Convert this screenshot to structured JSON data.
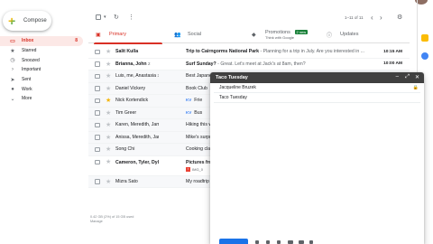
{
  "compose_label": "Compose",
  "nav": [
    {
      "label": "Inbox",
      "icon": "inbox-icon",
      "glyph": "▭",
      "count": "8",
      "active": true
    },
    {
      "label": "Starred",
      "icon": "star-icon",
      "glyph": "★",
      "count": ""
    },
    {
      "label": "Snoozed",
      "icon": "clock-icon",
      "glyph": "◷",
      "count": ""
    },
    {
      "label": "Important",
      "icon": "important-icon",
      "glyph": "›",
      "count": ""
    },
    {
      "label": "Sent",
      "icon": "send-icon",
      "glyph": "➤",
      "count": ""
    },
    {
      "label": "Work",
      "icon": "label-icon",
      "glyph": "●",
      "count": ""
    },
    {
      "label": "More",
      "icon": "chevron-down-icon",
      "glyph": "⌄",
      "count": ""
    }
  ],
  "toolbar": {
    "pagination": "1–11 of 11",
    "prev": "‹",
    "next": "›"
  },
  "tabs": {
    "primary": "Primary",
    "social": "Social",
    "promotions": "Promotions",
    "promotions_badge": "2 new",
    "promotions_sub": "Think with Google",
    "updates": "Updates"
  },
  "emails": [
    {
      "sender": "Salit Kulla",
      "subject": "Trip to Cairngorms National Park",
      "snippet": " - Planning for a trip in July. Are you interested in ...",
      "time": "10:15 AM",
      "unread": true,
      "starred": false
    },
    {
      "sender": "Brianna, John",
      "count": "2",
      "subject": "Surf Sunday?",
      "snippet": " - Great. Let's meet at Jack's at 8am, then?",
      "time": "10:00 AM",
      "unread": true,
      "starred": false
    },
    {
      "sender": "Luis, me, Anastasia",
      "count": "3",
      "subject": "Best Japanese",
      "snippet": "",
      "time": "",
      "unread": false,
      "starred": false
    },
    {
      "sender": "Daniel Vickery",
      "subject": "Book Club",
      "snippet": "",
      "time": "",
      "unread": false,
      "starred": false
    },
    {
      "sender": "Nick Kortendick",
      "tag": "KV",
      "subject": "Frie",
      "snippet": "",
      "time": "",
      "unread": false,
      "starred": true
    },
    {
      "sender": "Tim Greer",
      "tag": "KV",
      "subject": "Bus",
      "snippet": "",
      "time": "",
      "unread": false,
      "starred": false
    },
    {
      "sender": "Karen, Meredith, James",
      "count": "3",
      "subject": "Hiking this w",
      "snippet": "",
      "time": "",
      "unread": false,
      "starred": false
    },
    {
      "sender": "Anissa, Meredith, James",
      "count": "3",
      "subject": "Mike's surpri",
      "snippet": "",
      "time": "",
      "unread": false,
      "starred": false
    },
    {
      "sender": "Song Chi",
      "subject": "Cooking cla",
      "snippet": "",
      "time": "",
      "unread": false,
      "starred": false
    },
    {
      "sender": "Cameron, Tyler, Dylan",
      "count": "4",
      "subject": "Pictures fro",
      "snippet": "",
      "time": "",
      "unread": true,
      "starred": false,
      "attachment": "IMG_0"
    },
    {
      "sender": "Mizra Sato",
      "subject": "My roadtrip",
      "snippet": "",
      "time": "",
      "unread": false,
      "starred": false
    }
  ],
  "footer": {
    "storage": "0.42 GB (2%) of 15 GB used",
    "manage": "Manage"
  },
  "compose_window": {
    "title": "Taco Tuesday",
    "to": "Jacqueline Bruzek",
    "subject": "Taco Tuesday"
  }
}
